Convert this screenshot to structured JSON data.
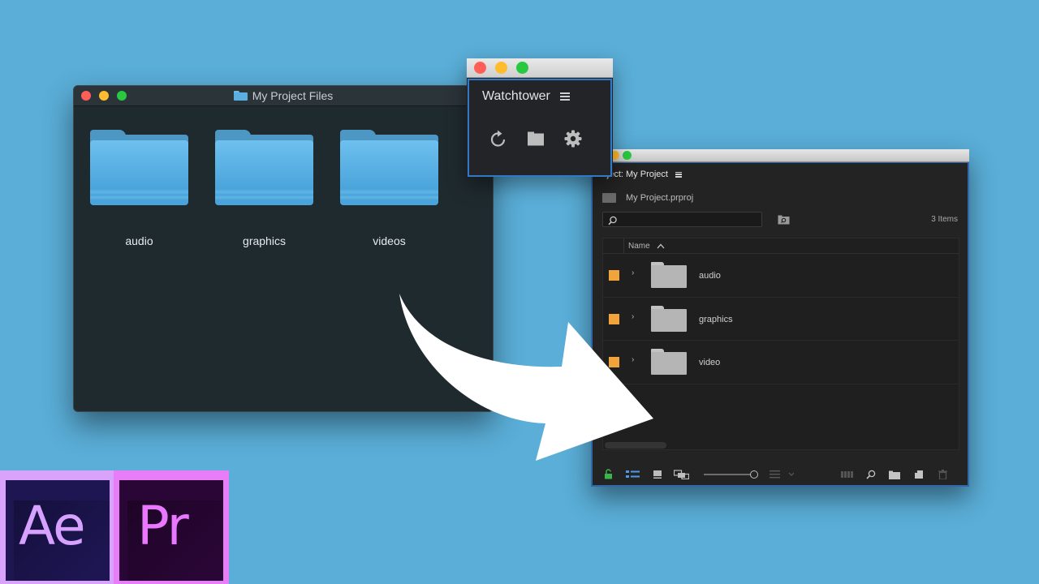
{
  "finder": {
    "title": "My Project Files",
    "folders": [
      {
        "label": "audio"
      },
      {
        "label": "graphics"
      },
      {
        "label": "videos"
      }
    ]
  },
  "watchtower": {
    "title": "Watchtower",
    "icons": [
      "refresh-icon",
      "folder-icon",
      "gear-icon"
    ]
  },
  "premiere": {
    "panel_title": "Project: My Project",
    "visible_title": "roject: My Project",
    "project_file": "My Project.prproj",
    "items_count": "3 Items",
    "column_name": "Name",
    "rows": [
      {
        "name": "audio",
        "color": "#f0a43a"
      },
      {
        "name": "graphics",
        "color": "#f0a43a"
      },
      {
        "name": "video",
        "color": "#f0a43a"
      }
    ],
    "accent_color": "#2f67a8"
  },
  "logos": {
    "ae": "Ae",
    "pr": "Pr"
  },
  "colors": {
    "background": "#5aaed8",
    "folder_blue": "#5aaee0",
    "panel_border": "#3178c6"
  }
}
